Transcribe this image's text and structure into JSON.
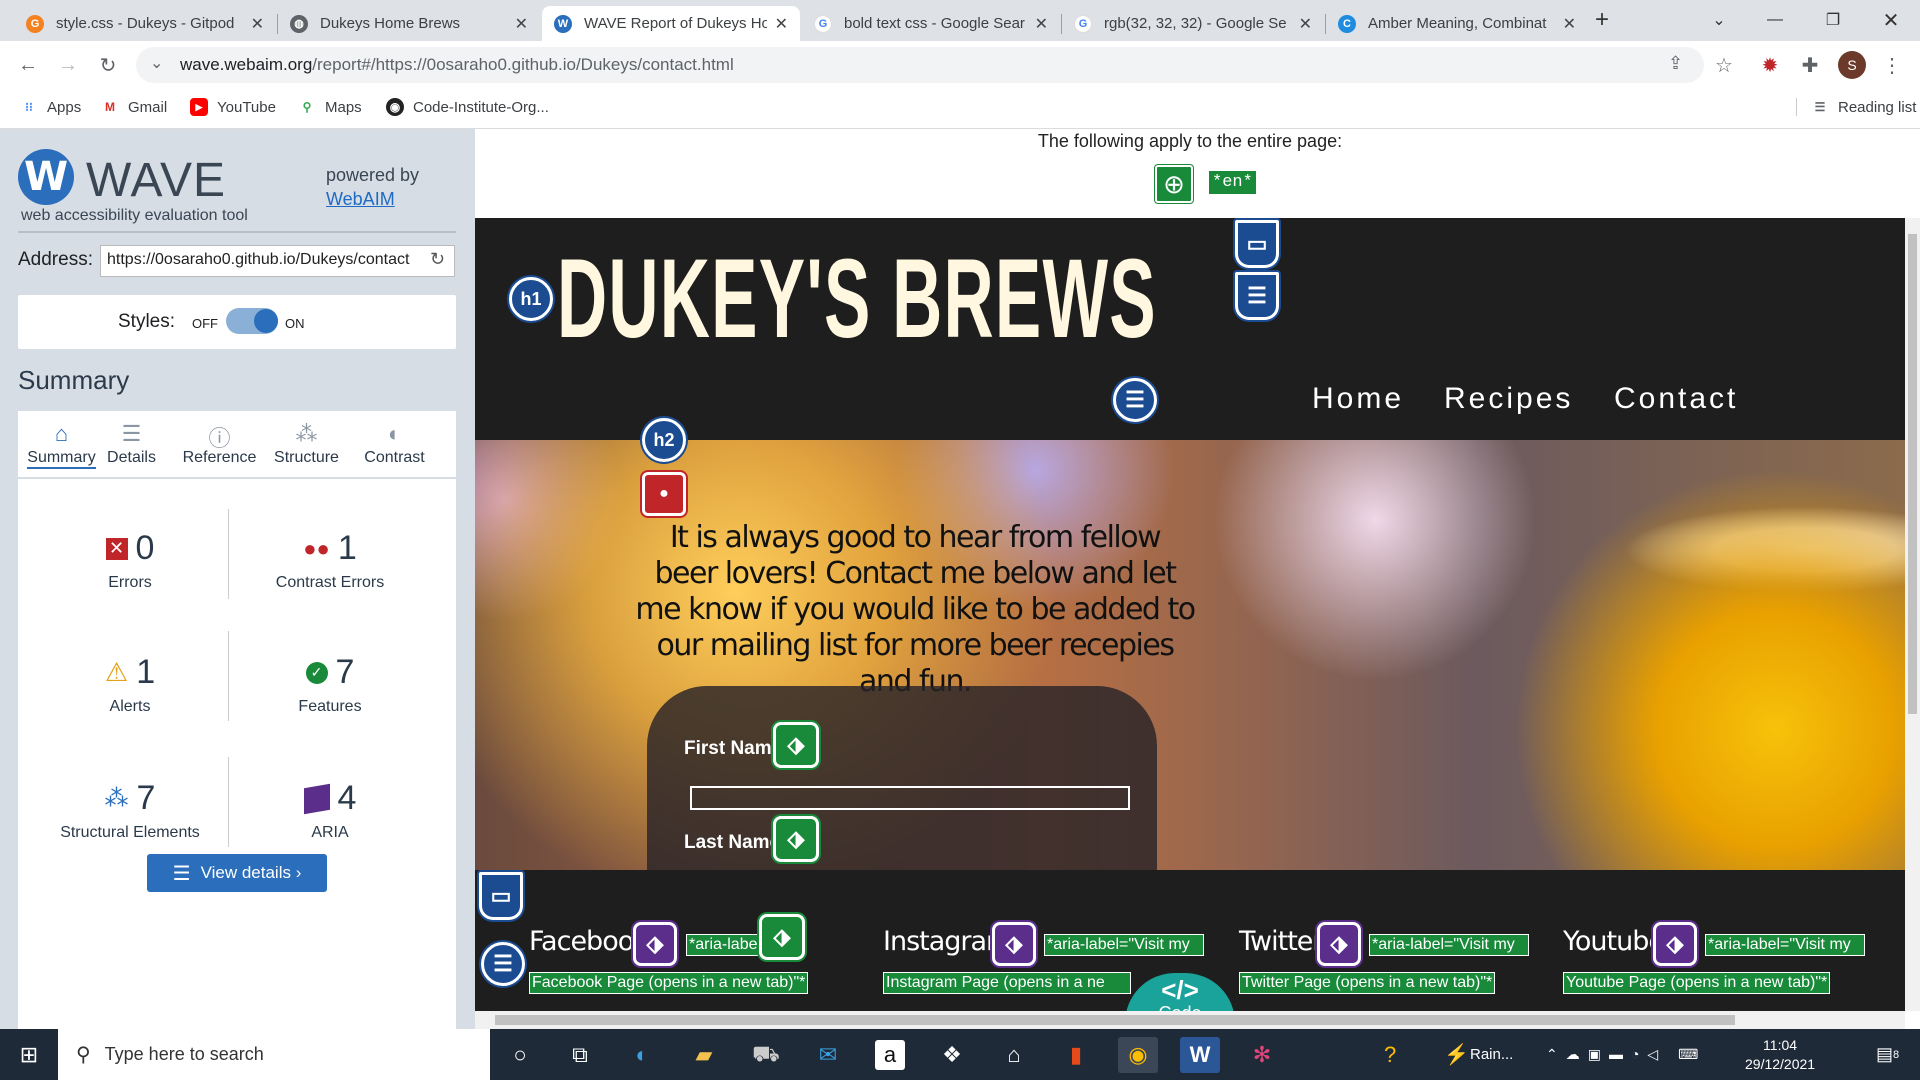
{
  "tabs": [
    {
      "title": "style.css - Dukeys - Gitpod",
      "icon": "gitpod-icon",
      "active": false
    },
    {
      "title": "Dukeys Home Brews",
      "icon": "globe-icon",
      "active": false
    },
    {
      "title": "WAVE Report of Dukeys Ho",
      "icon": "wave-icon",
      "active": true
    },
    {
      "title": "bold text css - Google Sear",
      "icon": "google-icon",
      "active": false
    },
    {
      "title": "rgb(32, 32, 32) - Google Se",
      "icon": "google-icon",
      "active": false
    },
    {
      "title": "Amber Meaning, Combinat",
      "icon": "site-icon",
      "active": false
    }
  ],
  "address": {
    "host": "wave.webaim.org",
    "path": "/report#/https://0osaraho0.github.io/Dukeys/contact.html"
  },
  "bookmarks": [
    {
      "label": "Apps",
      "icon": "apps-grid-icon"
    },
    {
      "label": "Gmail",
      "icon": "gmail-icon"
    },
    {
      "label": "YouTube",
      "icon": "youtube-icon"
    },
    {
      "label": "Maps",
      "icon": "maps-pin-icon"
    },
    {
      "label": "Code-Institute-Org...",
      "icon": "github-icon"
    }
  ],
  "reading_list": "Reading list",
  "profile_initial": "S",
  "wave": {
    "logo": "WAVE",
    "tagline": "web accessibility evaluation tool",
    "powered_by": "powered by",
    "webaim": "WebAIM",
    "address_label": "Address:",
    "address_value": "https://0osaraho0.github.io/Dukeys/contact",
    "styles_label": "Styles:",
    "styles_off": "OFF",
    "styles_on": "ON",
    "summary_heading": "Summary",
    "tabs": [
      "Summary",
      "Details",
      "Reference",
      "Structure",
      "Contrast"
    ],
    "stats": {
      "errors": {
        "value": "0",
        "label": "Errors"
      },
      "contrast_errors": {
        "value": "1",
        "label": "Contrast Errors"
      },
      "alerts": {
        "value": "1",
        "label": "Alerts"
      },
      "features": {
        "value": "7",
        "label": "Features"
      },
      "structural": {
        "value": "7",
        "label": "Structural Elements"
      },
      "aria": {
        "value": "4",
        "label": "ARIA"
      }
    },
    "view_details": "View details ›"
  },
  "report": {
    "apply_text": "The following apply to the entire page:",
    "lang": "*en*",
    "site_title": "DUKEY'S BREWS",
    "nav": [
      "Home",
      "Recipes",
      "Contact"
    ],
    "hero_text": "It is always good to hear from fellow beer lovers! Contact me below and let me know if you would like to be added to our mailing list for more beer recepies and fun.",
    "first_name": "First Name",
    "last_name": "Last Name",
    "social": [
      {
        "name": "Facebook",
        "aria": "*aria-label=\"Vi",
        "link": "Facebook Page (opens in a new tab)\"*"
      },
      {
        "name": "Instagram",
        "aria": "*aria-label=\"Visit my",
        "link": "Instagram Page (opens in a ne"
      },
      {
        "name": "Twitter",
        "aria": "*aria-label=\"Visit my",
        "link": "Twitter Page (opens in a new tab)\"*"
      },
      {
        "name": "Youtube",
        "aria": "*aria-label=\"Visit my",
        "link": "Youtube Page (opens in a new tab)\"*"
      }
    ],
    "icons": {
      "h1": "h1",
      "h2": "h2"
    },
    "code_label": "Code"
  },
  "taskbar": {
    "search_placeholder": "Type here to search",
    "weather": "Rain...",
    "time": "11:04",
    "date": "29/12/2021",
    "notifications": "8"
  }
}
